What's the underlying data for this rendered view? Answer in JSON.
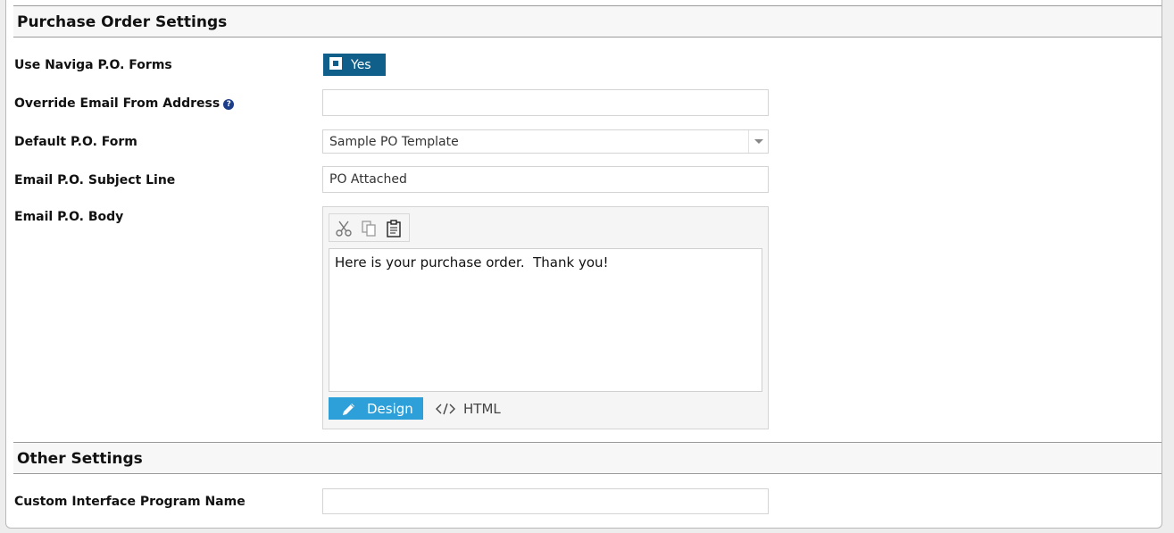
{
  "po_settings": {
    "title": "Purchase Order Settings",
    "use_forms": {
      "label": "Use Naviga P.O. Forms",
      "toggle_text": "Yes"
    },
    "override_email": {
      "label": "Override Email From Address",
      "help": "?",
      "value": ""
    },
    "default_form": {
      "label": "Default P.O. Form",
      "value": "Sample PO Template"
    },
    "subject_line": {
      "label": "Email P.O. Subject Line",
      "value": "PO Attached"
    },
    "body": {
      "label": "Email P.O. Body",
      "toolbar": {
        "cut_icon": "scissors-icon",
        "copy_icon": "copy-icon",
        "paste_icon": "clipboard-icon"
      },
      "content": "Here is your purchase order.  Thank you!",
      "design_label": "Design",
      "html_label": "HTML"
    }
  },
  "other_settings": {
    "title": "Other Settings",
    "program_name": {
      "label": "Custom Interface Program Name",
      "value": ""
    }
  },
  "colors": {
    "toggle_on": "#0f5f8a",
    "design_tab": "#2d9fd9",
    "help_icon": "#1c3d8a"
  }
}
